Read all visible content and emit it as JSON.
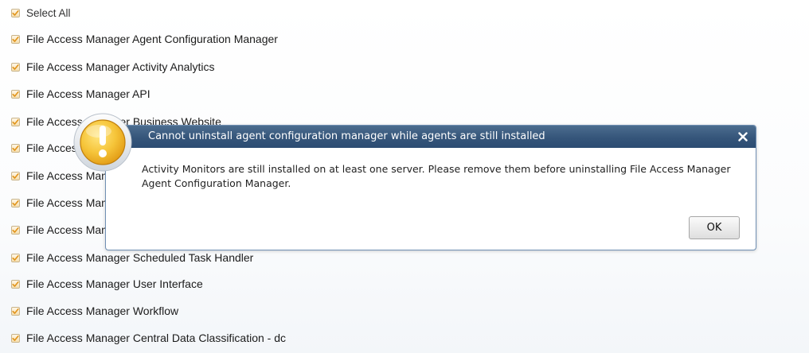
{
  "list": {
    "select_all_label": "Select All",
    "items": [
      "File Access Manager Agent Configuration Manager",
      "File Access Manager Activity Analytics",
      "File Access Manager API",
      "File Access Manager Business Website",
      "File Access Manager Collector Synchronizer",
      "File Access Manager Data Classification",
      "File Access Manager Event Manager",
      "File Access Manager Permission Collection",
      "File Access Manager Scheduled Task Handler",
      "File Access Manager User Interface",
      "File Access Manager Workflow",
      "File Access Manager Central Data Classification - dc"
    ]
  },
  "dialog": {
    "title": "Cannot uninstall agent configuration manager while agents are still installed",
    "message": "Activity Monitors are still installed on at least one server. Please remove them before uninstalling File Access Manager Agent Configuration Manager.",
    "ok_label": "OK",
    "close_icon": "close-icon",
    "warning_icon": "warning-icon"
  },
  "colors": {
    "title_bar": "#35557a",
    "checkbox_check": "#e0931a",
    "warning_fill": "#f4c53b"
  }
}
